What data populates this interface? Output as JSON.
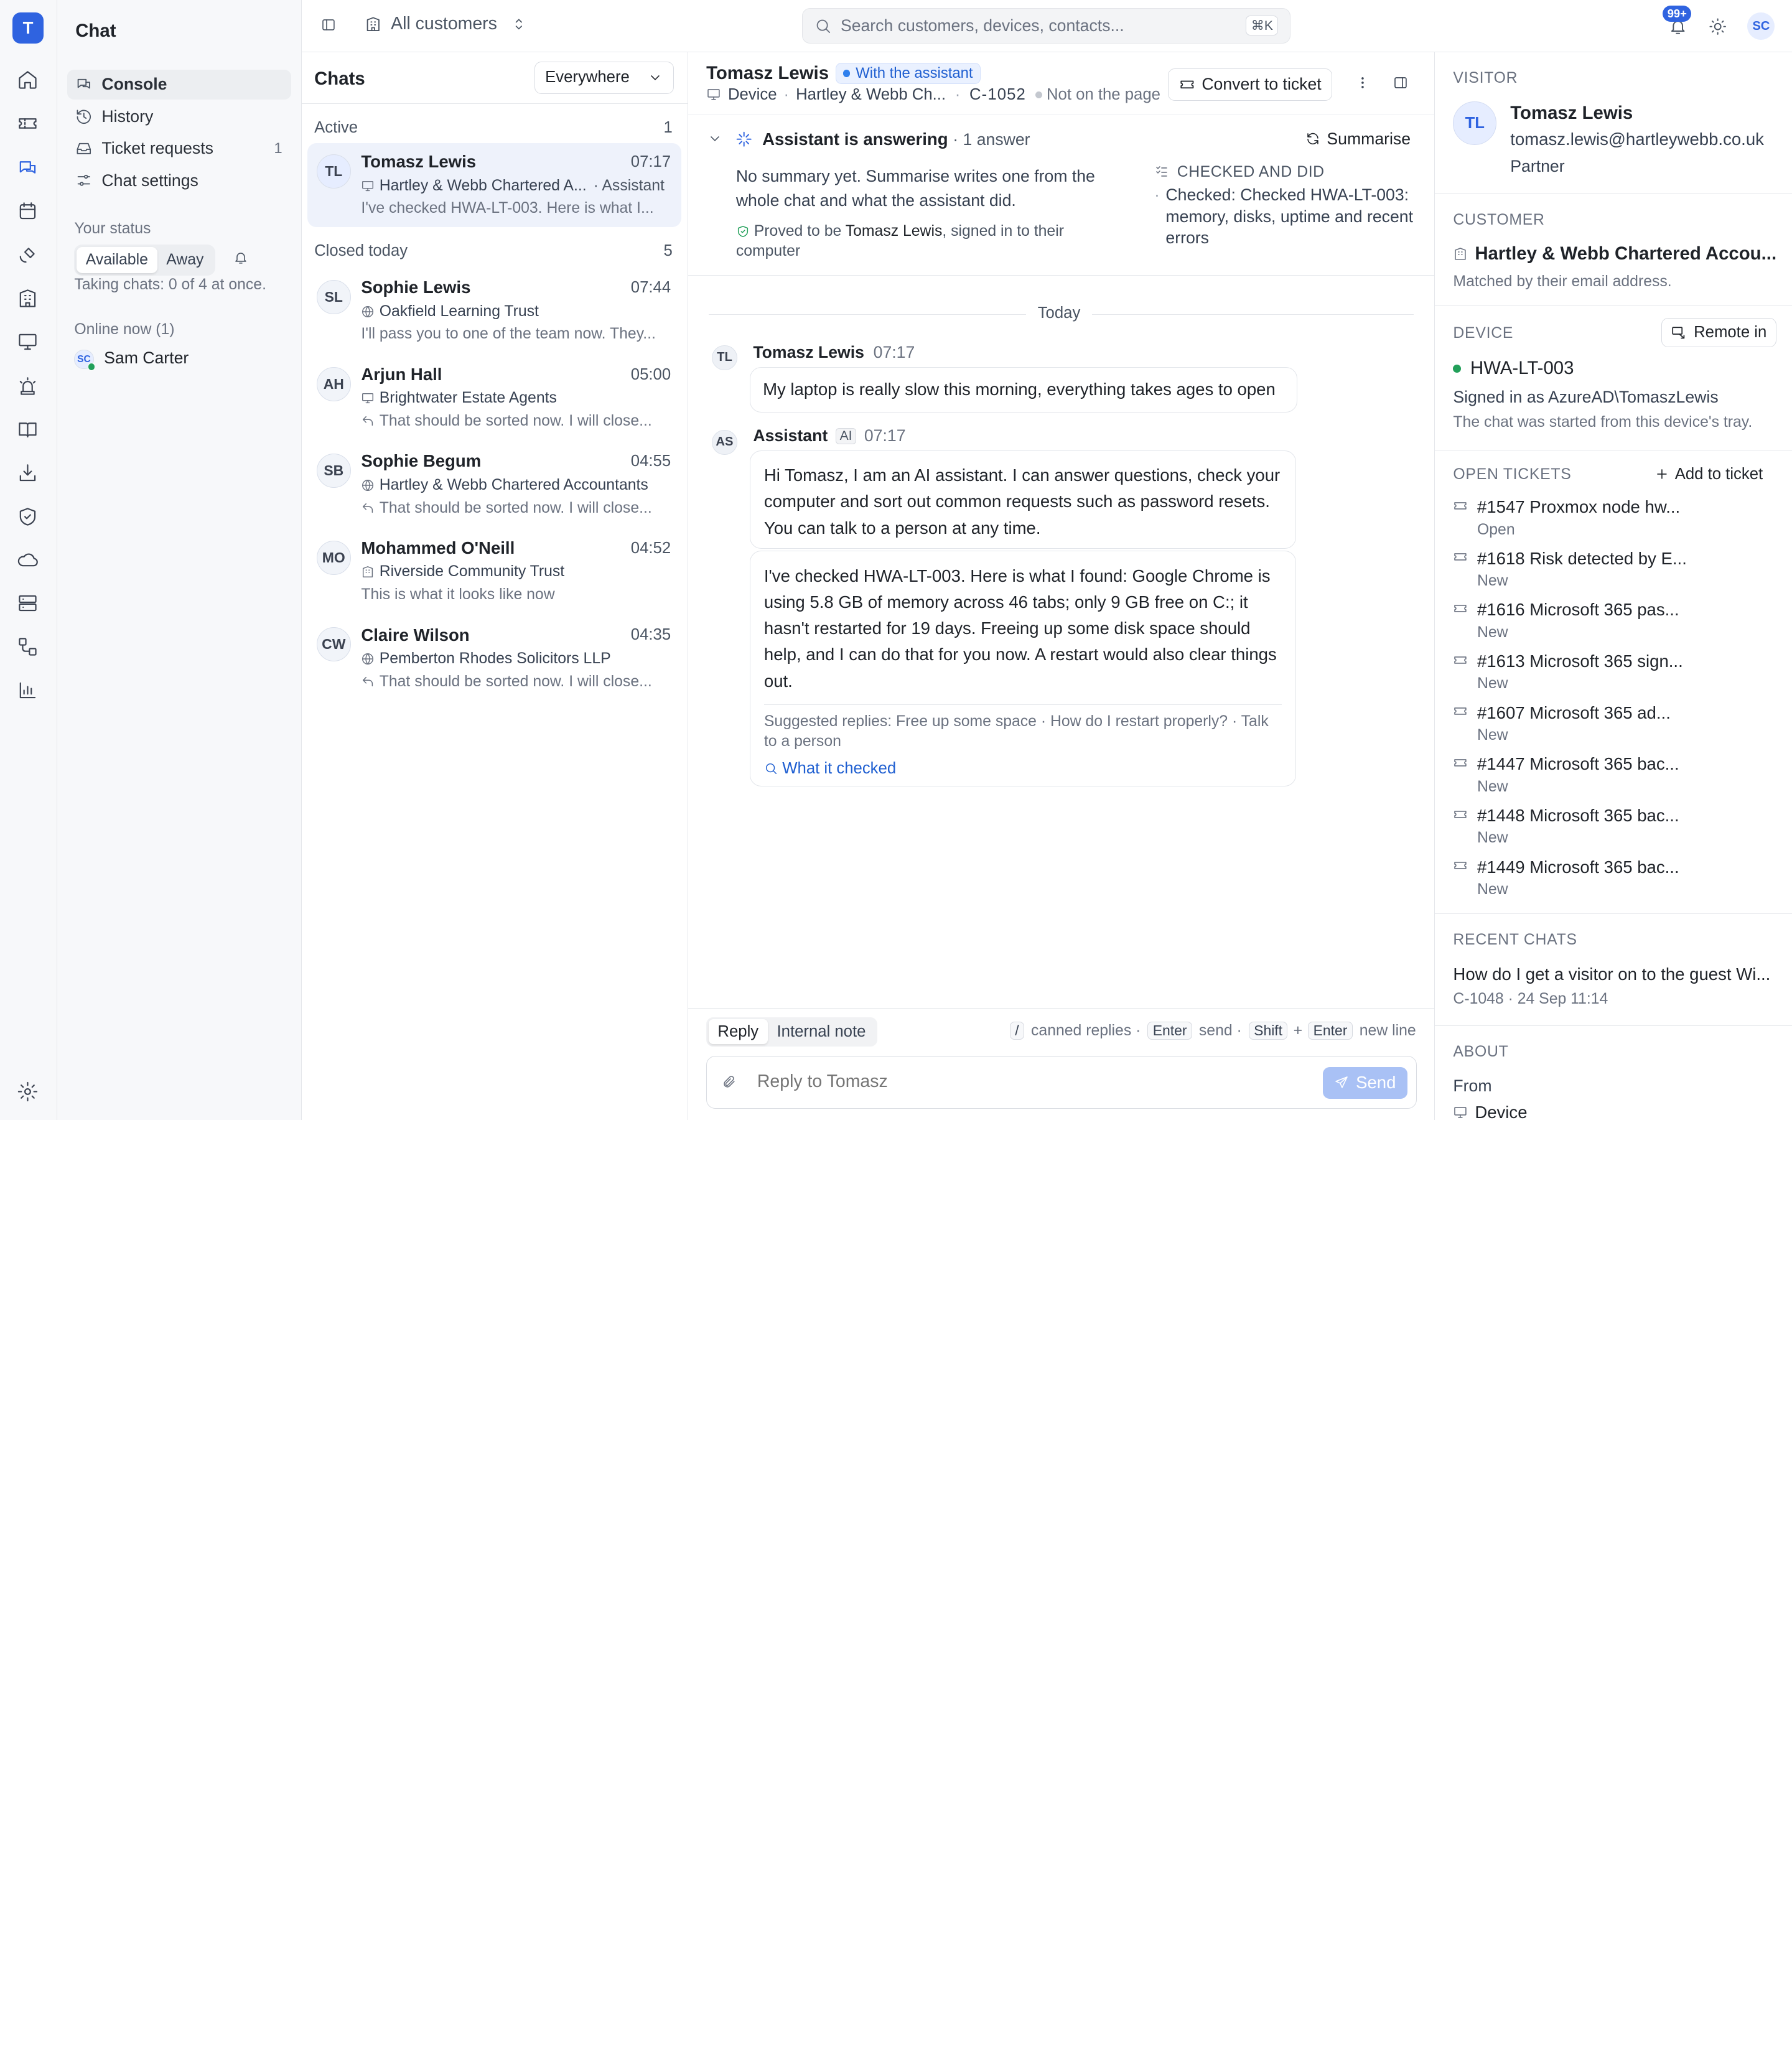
{
  "app": {
    "logo_letter": "T",
    "section_title": "Chat"
  },
  "nav": [
    {
      "label": "Console",
      "count": ""
    },
    {
      "label": "History",
      "count": ""
    },
    {
      "label": "Ticket requests",
      "count": "1"
    },
    {
      "label": "Chat settings",
      "count": ""
    }
  ],
  "status": {
    "title": "Your status",
    "options": [
      "Available",
      "Away"
    ],
    "selected": "Available",
    "capacity": "Taking chats: 0 of 4 at once.",
    "online_title": "Online now (1)",
    "online_user_initials": "SC",
    "online_user": "Sam Carter"
  },
  "topbar": {
    "scope": "All customers",
    "search_placeholder": "Search customers, devices, contacts...",
    "search_shortcut": "⌘K",
    "notif_count": "99+",
    "user_initials": "SC"
  },
  "chats": {
    "title": "Chats",
    "filter": "Everywhere",
    "active_label": "Active",
    "active_count": "1",
    "closed_label": "Closed today",
    "closed_count": "5",
    "active": [
      {
        "initials": "TL",
        "name": "Tomasz Lewis",
        "time": "07:17",
        "org": "Hartley & Webb Chartered A...",
        "org_suffix": "· Assistant",
        "preview": "I've checked HWA-LT-003. Here is what I..."
      }
    ],
    "closed": [
      {
        "initials": "SL",
        "name": "Sophie Lewis",
        "time": "07:44",
        "org": "Oakfield Learning Trust",
        "preview": "I'll pass you to one of the team now. They..."
      },
      {
        "initials": "AH",
        "name": "Arjun Hall",
        "time": "05:00",
        "org": "Brightwater Estate Agents",
        "preview": "That should be sorted now. I will close..."
      },
      {
        "initials": "SB",
        "name": "Sophie Begum",
        "time": "04:55",
        "org": "Hartley & Webb Chartered Accountants",
        "preview": "That should be sorted now. I will close..."
      },
      {
        "initials": "MO",
        "name": "Mohammed O'Neill",
        "time": "04:52",
        "org": "Riverside Community Trust",
        "preview": "This is what it looks like now"
      },
      {
        "initials": "CW",
        "name": "Claire Wilson",
        "time": "04:35",
        "org": "Pemberton Rhodes Solicitors LLP",
        "preview": "That should be sorted now. I will close..."
      }
    ]
  },
  "conversation": {
    "name": "Tomasz Lewis",
    "status_pill": "With the assistant",
    "meta_device": "Device",
    "meta_customer": "Hartley & Webb Ch...",
    "meta_chat_id": "C-1052",
    "meta_presence": "Not on the page",
    "convert_button": "Convert to ticket",
    "assistant": {
      "title": "Assistant is answering",
      "answers": "· 1 answer",
      "summarise": "Summarise",
      "summary": "No summary yet. Summarise writes one from the whole chat and what the assistant did.",
      "proved_prefix": "Proved to be",
      "proved_name": "Tomasz Lewis",
      "proved_suffix": ", signed in to their computer",
      "checked_title": "CHECKED AND DID",
      "checked_item": "Checked: Checked HWA-LT-003: memory, disks, uptime and recent errors"
    },
    "day_divider": "Today",
    "messages": [
      {
        "initials": "TL",
        "author": "Tomasz Lewis",
        "time": "07:17",
        "text": "My laptop is really slow this morning, everything takes ages to open"
      },
      {
        "initials": "AS",
        "author": "Assistant",
        "tag": "AI",
        "time": "07:17",
        "text": "Hi Tomasz, I am an AI assistant. I can answer questions, check your computer and sort out common requests such as password resets. You can talk to a person at any time.",
        "text2": "I've checked HWA-LT-003. Here is what I found: Google Chrome is using 5.8 GB of memory across 46 tabs; only 9 GB free on C:; it hasn't restarted for 19 days. Freeing up some disk space should help, and I can do that for you now. A restart would also clear things out.",
        "suggested": "Suggested replies: Free up some space · How do I restart properly? · Talk to a person",
        "what_checked": "What it checked"
      }
    ],
    "composer": {
      "tabs": [
        "Reply",
        "Internal note"
      ],
      "hint_slash": "/",
      "hint_canned": "canned replies ·",
      "hint_enter": "Enter",
      "hint_send": "send ·",
      "hint_shift": "Shift",
      "hint_plus": "+",
      "hint_enter2": "Enter",
      "hint_newline": "new line",
      "placeholder": "Reply to Tomasz",
      "send": "Send"
    }
  },
  "details": {
    "visitor_caption": "VISITOR",
    "visitor_initials": "TL",
    "visitor_name": "Tomasz Lewis",
    "visitor_email": "tomasz.lewis@hartleywebb.co.uk",
    "visitor_role": "Partner",
    "customer_caption": "CUSTOMER",
    "customer_name": "Hartley & Webb Chartered Accou...",
    "customer_note": "Matched by their email address.",
    "device_caption": "DEVICE",
    "remote_button": "Remote in",
    "device_name": "HWA-LT-003",
    "device_signed": "Signed in as AzureAD\\TomaszLewis",
    "device_note": "The chat was started from this device's tray.",
    "tickets_caption": "OPEN TICKETS",
    "add_ticket": "Add to ticket",
    "tickets": [
      {
        "title": "#1547 Proxmox node hw...",
        "status": "Open"
      },
      {
        "title": "#1618 Risk detected by E...",
        "status": "New"
      },
      {
        "title": "#1616 Microsoft 365 pas...",
        "status": "New"
      },
      {
        "title": "#1613 Microsoft 365 sign...",
        "status": "New"
      },
      {
        "title": "#1607 Microsoft 365 ad...",
        "status": "New"
      },
      {
        "title": "#1447 Microsoft 365 bac...",
        "status": "New"
      },
      {
        "title": "#1448 Microsoft 365 bac...",
        "status": "New"
      },
      {
        "title": "#1449 Microsoft 365 bac...",
        "status": "New"
      }
    ],
    "recent_caption": "RECENT CHATS",
    "recent_title": "How do I get a visitor on to the guest Wi...",
    "recent_meta": "C-1048 · 24 Sep 11:14",
    "about_caption": "ABOUT",
    "about_from_label": "From",
    "about_from_value": "Device"
  },
  "colors": {
    "accent": "#2f63e0",
    "online": "#22a05a"
  }
}
